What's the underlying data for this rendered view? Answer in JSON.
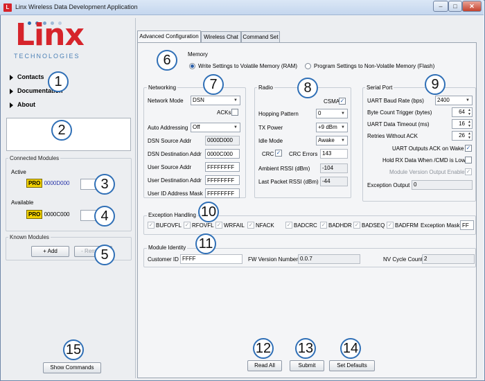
{
  "window": {
    "title": "Linx Wireless Data Development Application",
    "app_icon": "L",
    "min": "–",
    "max": "□",
    "close": "✕"
  },
  "logo": {
    "main": "Linx",
    "sub": "TECHNOLOGIES"
  },
  "nav": {
    "contacts": "Contacts",
    "documentation": "Documentation",
    "about": "About"
  },
  "connected": {
    "title": "Connected Modules",
    "active_label": "Active",
    "active_badge": "PRO",
    "active_addr": "0000D000",
    "available_label": "Available",
    "available_badge": "PRO",
    "available_addr": "0000C000"
  },
  "known": {
    "title": "Known Modules",
    "add": "+ Add",
    "remove": "- Remove"
  },
  "show_commands": "Show Commands",
  "tabs": [
    "Advanced Configuration",
    "Wireless Chat",
    "Command Set"
  ],
  "memory": {
    "title": "Memory",
    "opt_ram": "Write Settings to Volatile Memory (RAM)",
    "opt_flash": "Program Settings to Non-Volatile Memory (Flash)"
  },
  "networking": {
    "title": "Networking",
    "network_mode_label": "Network Mode",
    "network_mode": "DSN",
    "acks_label": "ACKs",
    "auto_addressing_label": "Auto Addressing",
    "auto_addressing": "Off",
    "dsn_source_label": "DSN Source Addr",
    "dsn_source": "0000D000",
    "dsn_dest_label": "DSN Destination Addr",
    "dsn_dest": "0000C000",
    "user_source_label": "User Source Addr",
    "user_source": "FFFFFFFF",
    "user_dest_label": "User Destination Addr",
    "user_dest": "FFFFFFFF",
    "user_mask_label": "User ID Address Mask",
    "user_mask": "FFFFFFFF"
  },
  "radio": {
    "title": "Radio",
    "csma_label": "CSMA",
    "hopping_label": "Hopping Pattern",
    "hopping": "0",
    "tx_power_label": "TX Power",
    "tx_power": "+9 dBm",
    "idle_label": "Idle Mode",
    "idle": "Awake",
    "crc_label": "CRC",
    "crc_errors_label": "CRC Errors",
    "crc_errors": "143",
    "rssi_label": "Ambient RSSI (dBm)",
    "rssi": "-104",
    "last_rssi_label": "Last Packet RSSI (dBm)",
    "last_rssi": "-44"
  },
  "serial": {
    "title": "Serial Port",
    "baud_label": "UART Baud Rate (bps)",
    "baud": "2400",
    "byte_count_label": "Byte Count Trigger (bytes)",
    "byte_count": "64",
    "timeout_label": "UART Data Timeout (ms)",
    "timeout": "16",
    "retries_label": "Retries Without ACK",
    "retries": "26",
    "ack_wake_label": "UART Outputs ACK on Wake",
    "hold_rx_label": "Hold RX Data When /CMD is Low",
    "version_out_label": "Module Version Output Enable",
    "exception_label": "Exception Output",
    "exception": "0"
  },
  "exceptions": {
    "title": "Exception Handling",
    "flags": [
      "BUFOVFL",
      "RFOVFL",
      "WRFAIL",
      "NFACK",
      "BADCRC",
      "BADHDR",
      "BADSEQ",
      "BADFRM"
    ],
    "mask_label": "Exception Mask",
    "mask": "FF"
  },
  "identity": {
    "title": "Module Identity",
    "customer_label": "Customer ID",
    "customer": "FFFF",
    "fw_label": "FW Version Number",
    "fw": "0.0.7",
    "nv_label": "NV Cycle Count",
    "nv": "2"
  },
  "actions": {
    "read_all": "Read All",
    "submit": "Submit",
    "set_defaults": "Set Defaults"
  },
  "callouts": [
    "1",
    "2",
    "3",
    "4",
    "5",
    "6",
    "7",
    "8",
    "9",
    "10",
    "11",
    "12",
    "13",
    "14",
    "15"
  ],
  "colors": {
    "brand_red": "#d6242b",
    "callout_blue": "#2f6fb6",
    "badge_yellow": "#f0d000"
  }
}
